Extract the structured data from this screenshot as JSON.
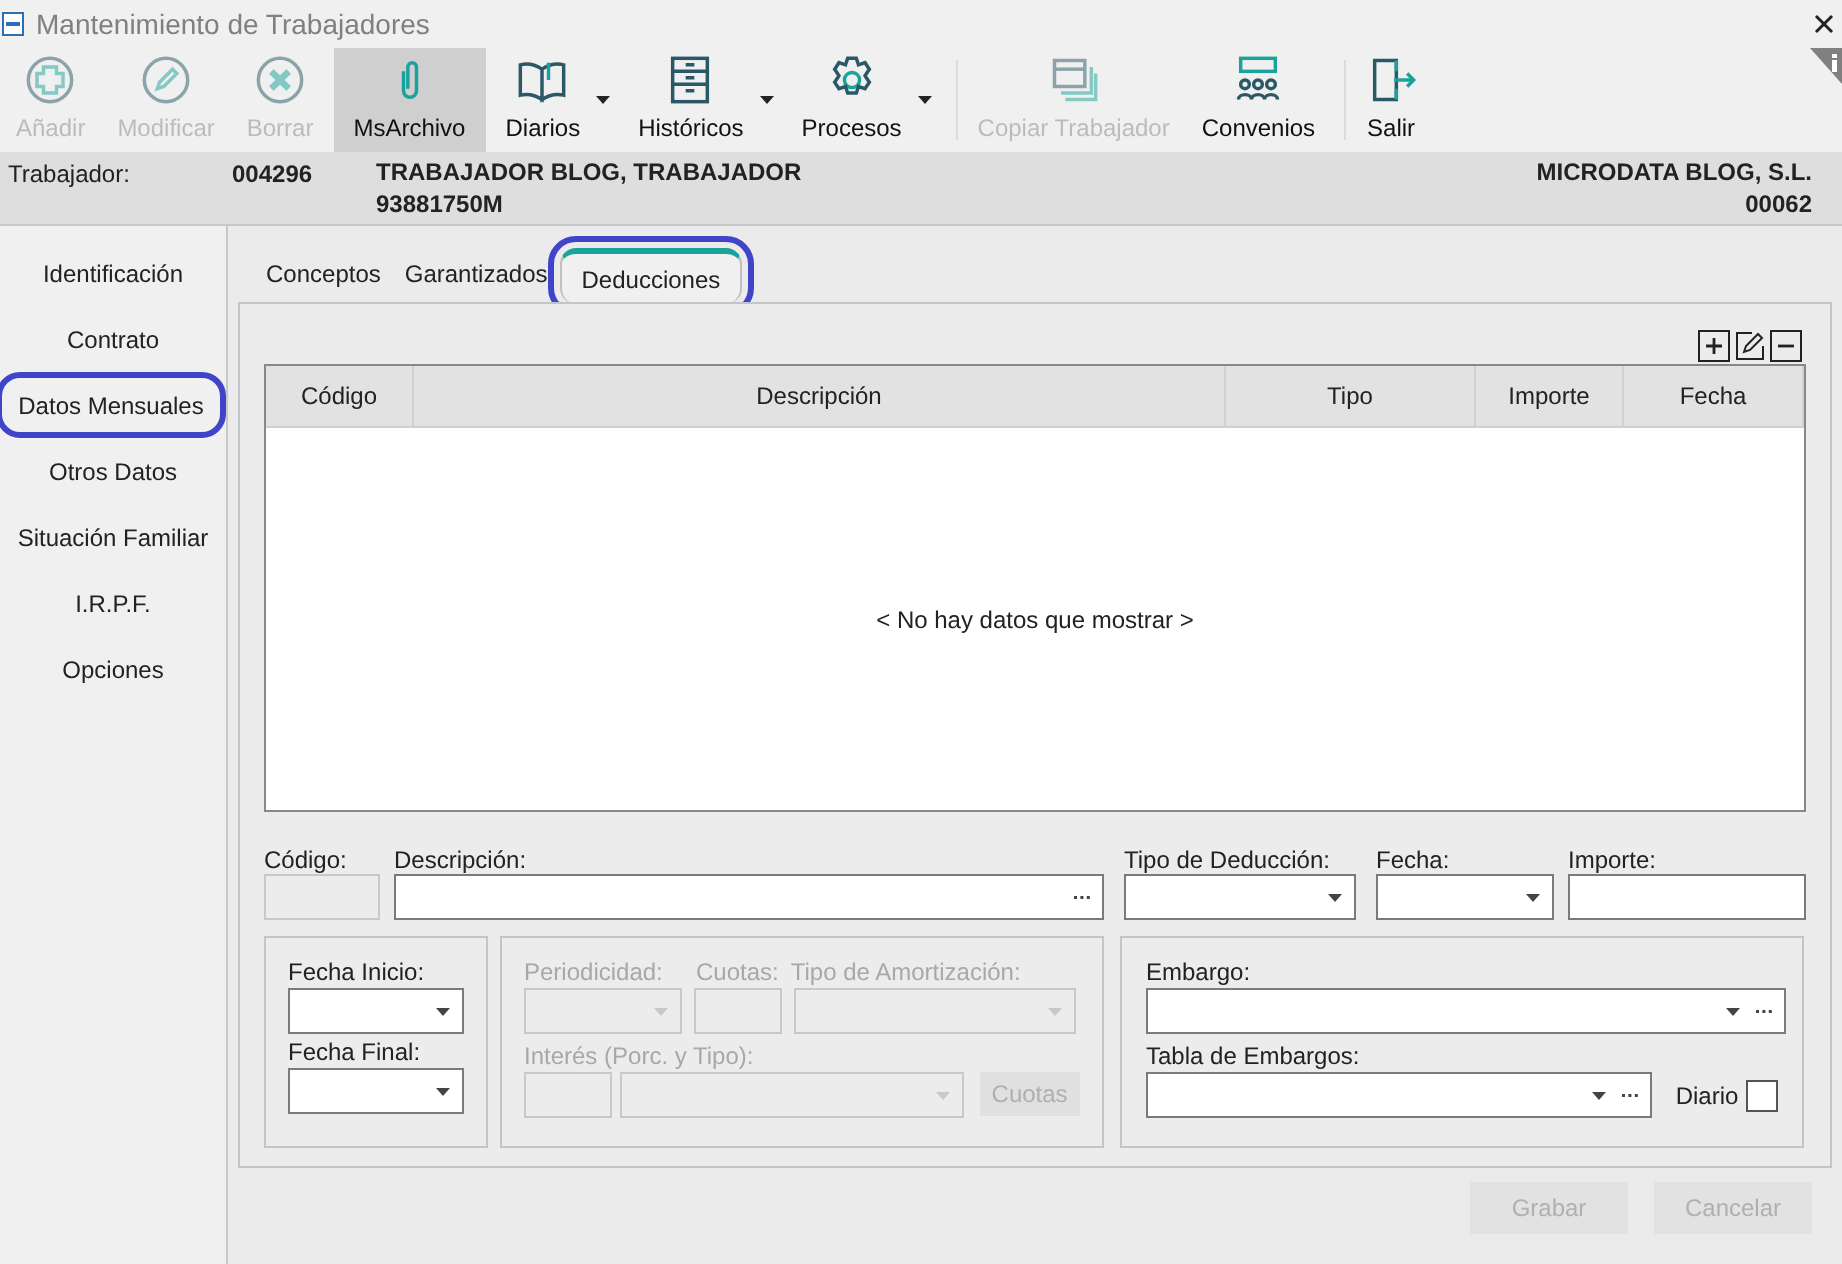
{
  "window": {
    "title": "Mantenimiento de Trabajadores"
  },
  "toolbar": [
    {
      "label": "Añadir",
      "disabled": true,
      "selected": false,
      "dropdown": false
    },
    {
      "label": "Modificar",
      "disabled": true,
      "selected": false,
      "dropdown": false
    },
    {
      "label": "Borrar",
      "disabled": true,
      "selected": false,
      "dropdown": false
    },
    {
      "label": "MsArchivo",
      "disabled": false,
      "selected": true,
      "dropdown": false
    },
    {
      "label": "Diarios",
      "disabled": false,
      "selected": false,
      "dropdown": true
    },
    {
      "label": "Históricos",
      "disabled": false,
      "selected": false,
      "dropdown": true
    },
    {
      "label": "Procesos",
      "disabled": false,
      "selected": false,
      "dropdown": true
    },
    {
      "label": "Copiar Trabajador",
      "disabled": true,
      "selected": false,
      "dropdown": false
    },
    {
      "label": "Convenios",
      "disabled": false,
      "selected": false,
      "dropdown": false
    },
    {
      "label": "Salir",
      "disabled": false,
      "selected": false,
      "dropdown": false
    }
  ],
  "header": {
    "label": "Trabajador:",
    "code": "004296",
    "name": "TRABAJADOR BLOG, TRABAJADOR",
    "nif": "93881750M",
    "company": "MICRODATA BLOG, S.L.",
    "company_code": "00062"
  },
  "sidebar": {
    "items": [
      {
        "label": "Identificación",
        "highlighted": false
      },
      {
        "label": "Contrato",
        "highlighted": false
      },
      {
        "label": "Datos Mensuales",
        "highlighted": true
      },
      {
        "label": "Otros Datos",
        "highlighted": false
      },
      {
        "label": "Situación Familiar",
        "highlighted": false
      },
      {
        "label": "I.R.P.F.",
        "highlighted": false
      },
      {
        "label": "Opciones",
        "highlighted": false
      }
    ]
  },
  "tabs": [
    {
      "label": "Conceptos",
      "selected": false,
      "highlighted": false
    },
    {
      "label": "Garantizados",
      "selected": false,
      "highlighted": false
    },
    {
      "label": "Deducciones",
      "selected": true,
      "highlighted": true
    }
  ],
  "table": {
    "columns": [
      "Código",
      "Descripción",
      "Tipo",
      "Importe",
      "Fecha"
    ],
    "empty_message": "< No hay datos que mostrar >"
  },
  "detail": {
    "fields": [
      {
        "label": "Código:",
        "kind": "text",
        "disabled": true
      },
      {
        "label": "Descripción:",
        "kind": "lookup",
        "disabled": false
      },
      {
        "label": "Tipo de Deducción:",
        "kind": "select",
        "disabled": false
      },
      {
        "label": "Fecha:",
        "kind": "select",
        "disabled": false
      },
      {
        "label": "Importe:",
        "kind": "text",
        "disabled": false
      }
    ]
  },
  "dates": {
    "fields": [
      {
        "label": "Fecha Inicio:",
        "kind": "select"
      },
      {
        "label": "Fecha Final:",
        "kind": "select"
      }
    ]
  },
  "amortization": {
    "disabled": true,
    "periodicity_label": "Periodicidad:",
    "quotas_label": "Cuotas:",
    "type_label": "Tipo de Amortización:",
    "interest_label": "Interés (Porc. y Tipo):",
    "button": "Cuotas"
  },
  "embargo": {
    "embargo_label": "Embargo:",
    "table_label": "Tabla de Embargos:",
    "daily": {
      "label": "Diario",
      "checked": false
    }
  },
  "buttons": [
    {
      "label": "Grabar",
      "disabled": true
    },
    {
      "label": "Cancelar",
      "disabled": true
    }
  ]
}
